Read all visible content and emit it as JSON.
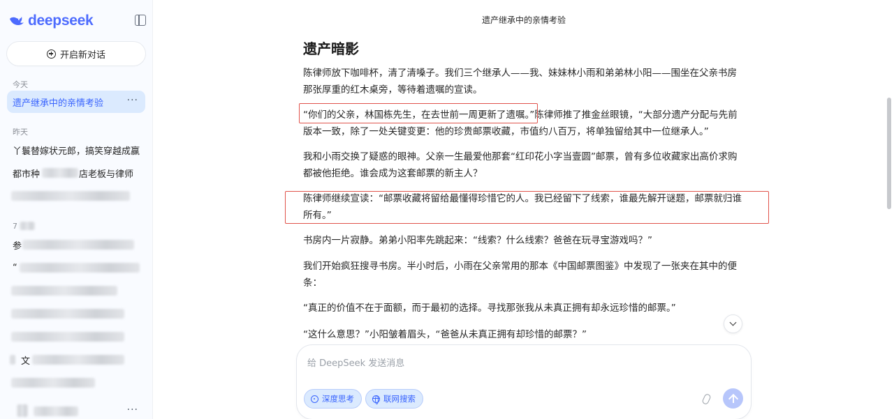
{
  "sidebar": {
    "logo_text": "deepseek",
    "new_chat_label": "开启新对话",
    "today_label": "今天",
    "today_items": [
      {
        "label": "遗产继承中的亲情考验",
        "more": "···"
      }
    ],
    "yesterday_label": "昨天",
    "yesterday_items": [
      {
        "label": "丫鬟替嫁状元郎，搞笑穿越成赢"
      },
      {
        "label": "都市种"
      },
      {
        "label": "店老板与律师"
      }
    ],
    "older_label_prefix": "7",
    "older_items": [
      {
        "label": "参"
      },
      {
        "label": "“"
      },
      {
        "label": "文"
      }
    ],
    "last_item_more": "···"
  },
  "main": {
    "title": "遗产继承中的亲情考验",
    "heading": "遗产暗影",
    "paragraphs": [
      "陈律师放下咖啡杯，清了清嗓子。我们三个继承人——我、妹妹林小雨和弟弟林小阳——围坐在父亲书房那张厚重的红木桌旁，等待着遗嘱的宣读。",
      "“你们的父亲，林国栋先生，在去世前一周更新了遗嘱。”陈律师推了推金丝眼镜，“大部分遗产分配与先前版本一致，除了一处关键变更：他的珍贵邮票收藏，市值约八百万，将单独留给其中一位继承人。”",
      "我和小雨交换了疑惑的眼神。父亲一生最爱他那套“红印花小字当壹圆”邮票，曾有多位收藏家出高价求购都被他拒绝。谁会成为这套邮票的新主人？",
      "陈律师继续宣读：“邮票收藏将留给最懂得珍惜它的人。我已经留下了线索，谁最先解开谜题，邮票就归谁所有。”",
      "书房内一片寂静。弟弟小阳率先跳起来：“线索？什么线索？爸爸在玩寻宝游戏吗？”",
      "我们开始疯狂搜寻书房。半小时后，小雨在父亲常用的那本《中国邮票图鉴》中发现了一张夹在其中的便条：",
      "“真正的价值不在于面额，而于最初的选择。寻找那张我从未真正拥有却永远珍惜的邮票。”",
      "“这什么意思？”小阳皱着眉头，“爸爸从未真正拥有却珍惜的邮票？”"
    ]
  },
  "composer": {
    "placeholder": "给 DeepSeek 发送消息",
    "deep_think_label": "深度思考",
    "web_search_label": "联网搜索"
  },
  "colors": {
    "accent": "#4d6bfe",
    "active_bg": "#dbeafe",
    "highlight_border": "#e0524a",
    "send_disabled": "#b7c6fb"
  },
  "icons": [
    "whale-logo-icon",
    "sidebar-toggle-icon",
    "plus-circle-icon",
    "more-icon",
    "chevron-down-icon",
    "atom-icon",
    "globe-icon",
    "paperclip-icon",
    "arrow-up-icon"
  ]
}
